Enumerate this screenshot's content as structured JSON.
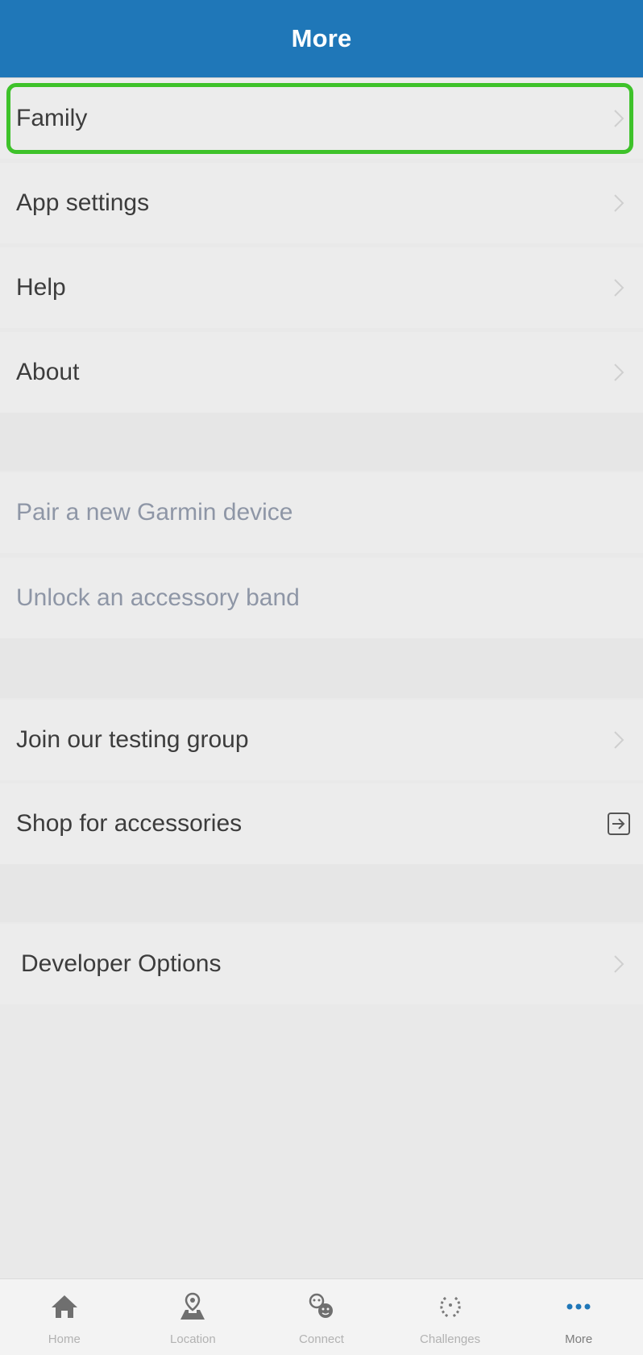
{
  "header": {
    "title": "More"
  },
  "menu": {
    "group1": [
      {
        "label": "Family"
      },
      {
        "label": "App settings"
      },
      {
        "label": "Help"
      },
      {
        "label": "About"
      }
    ],
    "group2": [
      {
        "label": "Pair a new Garmin device"
      },
      {
        "label": "Unlock an accessory band"
      }
    ],
    "group3": [
      {
        "label": "Join our testing group"
      },
      {
        "label": "Shop for accessories"
      }
    ],
    "group4": [
      {
        "label": "Developer Options"
      }
    ]
  },
  "tabs": [
    {
      "label": "Home",
      "icon": "home-icon"
    },
    {
      "label": "Location",
      "icon": "location-icon"
    },
    {
      "label": "Connect",
      "icon": "connect-icon"
    },
    {
      "label": "Challenges",
      "icon": "challenges-icon"
    },
    {
      "label": "More",
      "icon": "more-icon",
      "active": true
    }
  ],
  "colors": {
    "header": "#1f77b8",
    "highlight": "#3ec22a",
    "link_text": "#8e96a6"
  }
}
